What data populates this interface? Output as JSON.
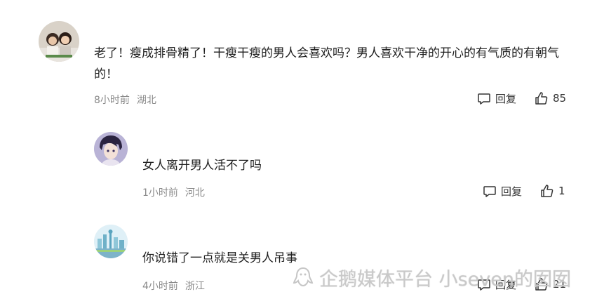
{
  "comments": [
    {
      "avatar_icon": "user-avatar-photo",
      "text": "老了！瘦成排骨精了！干瘦干瘦的男人会喜欢吗？男人喜欢干净的开心的有气质的有朝气的！",
      "time": "8小时前",
      "location": "湖北",
      "reply_label": "回复",
      "like_count": "85"
    },
    {
      "avatar_icon": "anime-boy-avatar",
      "text": "女人离开男人活不了吗",
      "time": "1小时前",
      "location": "河北",
      "reply_label": "回复",
      "like_count": "1"
    },
    {
      "avatar_icon": "city-skyline-avatar",
      "text": "你说错了一点就是关男人吊事",
      "time": "4小时前",
      "location": "浙江",
      "reply_label": "回复",
      "like_count": "21"
    }
  ],
  "watermark": {
    "logo_icon": "penguin-logo-icon",
    "text": "企鹅媒体平台 小seven的囡囡"
  }
}
